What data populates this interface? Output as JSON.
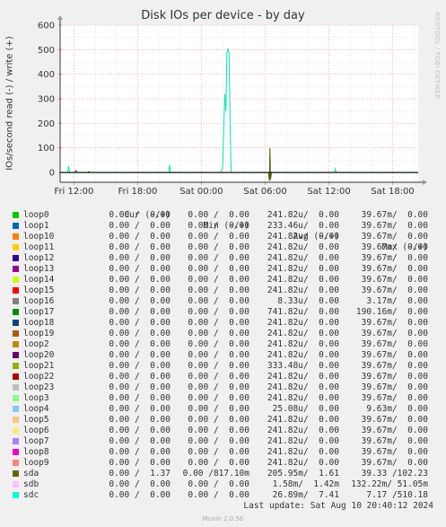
{
  "title": "Disk IOs per device - by day",
  "watermark": "RRDTOOL / TOBI OETIKER",
  "colors": {
    "background": "#f0f0f0",
    "plot_background": "#ffffff",
    "grid": "#ff8080",
    "axis": "#333333"
  },
  "chart_data": {
    "type": "line",
    "title": "Disk IOs per device - by day",
    "ylabel": "IOs/second read (-) / write (+)",
    "xlabel": "",
    "ylim": [
      -40,
      600
    ],
    "yticks": [
      "600",
      "500",
      "400",
      "300",
      "200",
      "100",
      "0"
    ],
    "ytick_values": [
      600,
      500,
      400,
      300,
      200,
      100,
      0
    ],
    "xticks": [
      "Fri 12:00",
      "Fri 18:00",
      "Sat 00:00",
      "Sat 06:00",
      "Sat 12:00",
      "Sat 18:00"
    ],
    "xtick_hours": [
      0,
      6,
      12,
      18,
      24,
      30
    ],
    "x_range_hours": [
      -1.3,
      32.4
    ],
    "grid": true,
    "series": [
      {
        "name": "sdc",
        "color": "#00e8b4",
        "points": [
          [
            -1.3,
            0
          ],
          [
            -0.6,
            0
          ],
          [
            -0.5,
            25
          ],
          [
            -0.4,
            0
          ],
          [
            8.9,
            0
          ],
          [
            9.0,
            30
          ],
          [
            9.1,
            0
          ],
          [
            13.8,
            0
          ],
          [
            14.0,
            20
          ],
          [
            14.2,
            320
          ],
          [
            14.3,
            250
          ],
          [
            14.4,
            490
          ],
          [
            14.5,
            505
          ],
          [
            14.6,
            480
          ],
          [
            14.7,
            200
          ],
          [
            14.8,
            0
          ],
          [
            24.5,
            0
          ],
          [
            24.6,
            15
          ],
          [
            24.7,
            0
          ],
          [
            32.4,
            0
          ]
        ]
      },
      {
        "name": "sda",
        "color": "#4d5d00",
        "points": [
          [
            -1.3,
            0
          ],
          [
            0.1,
            0
          ],
          [
            0.2,
            8
          ],
          [
            0.3,
            0
          ],
          [
            1.3,
            0
          ],
          [
            1.4,
            4
          ],
          [
            1.5,
            0
          ],
          [
            18.3,
            0
          ],
          [
            18.4,
            -35
          ],
          [
            18.45,
            100
          ],
          [
            18.5,
            -30
          ],
          [
            18.6,
            0
          ],
          [
            32.4,
            0
          ]
        ]
      }
    ]
  },
  "legend": {
    "headers": {
      "cur": "Cur (-/+)",
      "min": "Min (-/+)",
      "avg": "Avg (-/+)",
      "max": "Max (-/+)"
    },
    "rows": [
      {
        "name": "loop0",
        "color": "#00cc00",
        "cur": "0.00 /  0.00",
        "min": "0.00 /  0.00",
        "avg": "241.82u/  0.00",
        "max": "39.67m/  0.00"
      },
      {
        "name": "loop1",
        "color": "#0066b3",
        "cur": "0.00 /  0.00",
        "min": "0.00 /  0.00",
        "avg": "233.46u/  0.00",
        "max": "39.67m/  0.00"
      },
      {
        "name": "loop10",
        "color": "#ff8000",
        "cur": "0.00 /  0.00",
        "min": "0.00 /  0.00",
        "avg": "241.82u/  0.00",
        "max": "39.67m/  0.00"
      },
      {
        "name": "loop11",
        "color": "#ffcc00",
        "cur": "0.00 /  0.00",
        "min": "0.00 /  0.00",
        "avg": "241.82u/  0.00",
        "max": "39.67m/  0.00"
      },
      {
        "name": "loop12",
        "color": "#330099",
        "cur": "0.00 /  0.00",
        "min": "0.00 /  0.00",
        "avg": "241.82u/  0.00",
        "max": "39.67m/  0.00"
      },
      {
        "name": "loop13",
        "color": "#990099",
        "cur": "0.00 /  0.00",
        "min": "0.00 /  0.00",
        "avg": "241.82u/  0.00",
        "max": "39.67m/  0.00"
      },
      {
        "name": "loop14",
        "color": "#ccff00",
        "cur": "0.00 /  0.00",
        "min": "0.00 /  0.00",
        "avg": "241.82u/  0.00",
        "max": "39.67m/  0.00"
      },
      {
        "name": "loop15",
        "color": "#ff0000",
        "cur": "0.00 /  0.00",
        "min": "0.00 /  0.00",
        "avg": "241.82u/  0.00",
        "max": "39.67m/  0.00"
      },
      {
        "name": "loop16",
        "color": "#808080",
        "cur": "0.00 /  0.00",
        "min": "0.00 /  0.00",
        "avg": "8.33u/  0.00",
        "max": "3.17m/  0.00"
      },
      {
        "name": "loop17",
        "color": "#008f00",
        "cur": "0.00 /  0.00",
        "min": "0.00 /  0.00",
        "avg": "741.82u/  0.00",
        "max": "190.16m/  0.00"
      },
      {
        "name": "loop18",
        "color": "#00487d",
        "cur": "0.00 /  0.00",
        "min": "0.00 /  0.00",
        "avg": "241.82u/  0.00",
        "max": "39.67m/  0.00"
      },
      {
        "name": "loop19",
        "color": "#b35a00",
        "cur": "0.00 /  0.00",
        "min": "0.00 /  0.00",
        "avg": "241.82u/  0.00",
        "max": "39.67m/  0.00"
      },
      {
        "name": "loop2",
        "color": "#b38f00",
        "cur": "0.00 /  0.00",
        "min": "0.00 /  0.00",
        "avg": "241.82u/  0.00",
        "max": "39.67m/  0.00"
      },
      {
        "name": "loop20",
        "color": "#6b006b",
        "cur": "0.00 /  0.00",
        "min": "0.00 /  0.00",
        "avg": "241.82u/  0.00",
        "max": "39.67m/  0.00"
      },
      {
        "name": "loop21",
        "color": "#8fb300",
        "cur": "0.00 /  0.00",
        "min": "0.00 /  0.00",
        "avg": "333.48u/  0.00",
        "max": "39.67m/  0.00"
      },
      {
        "name": "loop22",
        "color": "#b30000",
        "cur": "0.00 /  0.00",
        "min": "0.00 /  0.00",
        "avg": "241.82u/  0.00",
        "max": "39.67m/  0.00"
      },
      {
        "name": "loop23",
        "color": "#bebebe",
        "cur": "0.00 /  0.00",
        "min": "0.00 /  0.00",
        "avg": "241.82u/  0.00",
        "max": "39.67m/  0.00"
      },
      {
        "name": "loop3",
        "color": "#80ff80",
        "cur": "0.00 /  0.00",
        "min": "0.00 /  0.00",
        "avg": "241.82u/  0.00",
        "max": "39.67m/  0.00"
      },
      {
        "name": "loop4",
        "color": "#80c9ff",
        "cur": "0.00 /  0.00",
        "min": "0.00 /  0.00",
        "avg": "25.08u/  0.00",
        "max": "9.63m/  0.00"
      },
      {
        "name": "loop5",
        "color": "#ffc080",
        "cur": "0.00 /  0.00",
        "min": "0.00 /  0.00",
        "avg": "241.82u/  0.00",
        "max": "39.67m/  0.00"
      },
      {
        "name": "loop6",
        "color": "#ffe680",
        "cur": "0.00 /  0.00",
        "min": "0.00 /  0.00",
        "avg": "241.82u/  0.00",
        "max": "39.67m/  0.00"
      },
      {
        "name": "loop7",
        "color": "#aa80ff",
        "cur": "0.00 /  0.00",
        "min": "0.00 /  0.00",
        "avg": "241.82u/  0.00",
        "max": "39.67m/  0.00"
      },
      {
        "name": "loop8",
        "color": "#ee00cc",
        "cur": "0.00 /  0.00",
        "min": "0.00 /  0.00",
        "avg": "241.82u/  0.00",
        "max": "39.67m/  0.00"
      },
      {
        "name": "loop9",
        "color": "#ff8080",
        "cur": "0.00 /  0.00",
        "min": "0.00 /  0.00",
        "avg": "241.82u/  0.00",
        "max": "39.67m/  0.00"
      },
      {
        "name": "sda",
        "color": "#666600",
        "cur": "0.00 /  1.37",
        "min": "0.00 /817.10m",
        "avg": "205.95m/  1.61",
        "max": "39.33 /102.23"
      },
      {
        "name": "sdb",
        "color": "#ffbfff",
        "cur": "0.00 /  0.00",
        "min": "0.00 /  0.00",
        "avg": "1.58m/  1.42m",
        "max": "132.22m/ 51.05m"
      },
      {
        "name": "sdc",
        "color": "#00ffcc",
        "cur": "0.00 /  0.00",
        "min": "0.00 /  0.00",
        "avg": "26.89m/  7.41",
        "max": "7.17 /510.18"
      }
    ]
  },
  "last_update": "Last update: Sat Aug 10 20:40:12 2024",
  "footer": "Munin 2.0.56"
}
